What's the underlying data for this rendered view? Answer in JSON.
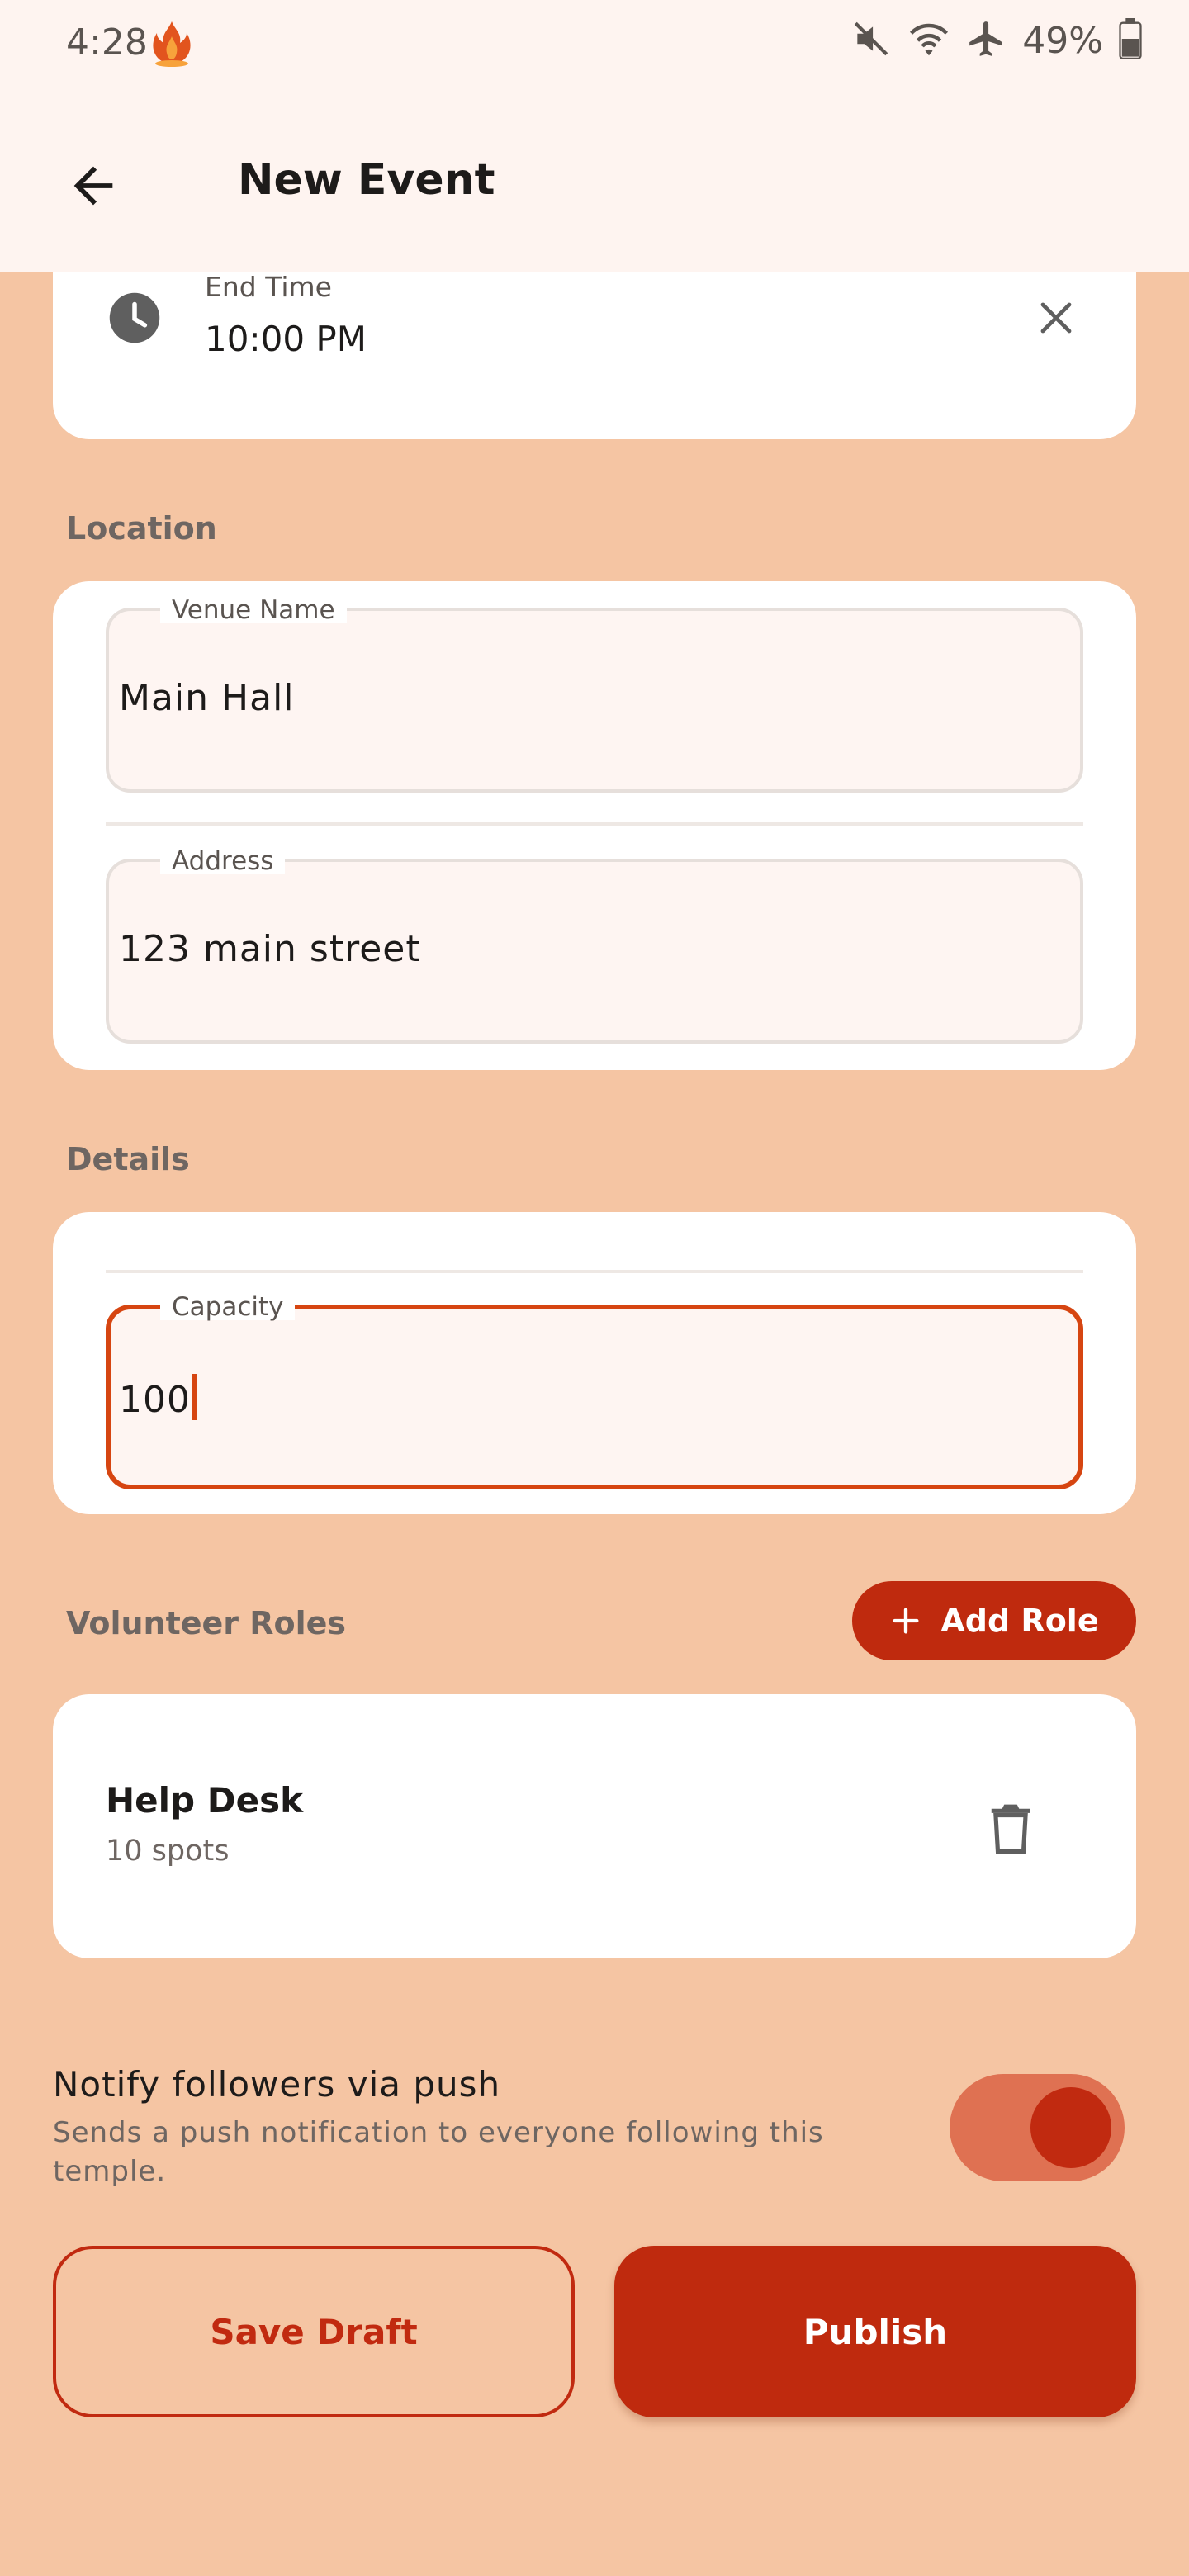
{
  "status_bar": {
    "time": "4:28",
    "battery": "49%",
    "icons": [
      "app-flame-icon",
      "muted-icon",
      "wifi-icon",
      "airplane-icon",
      "battery-icon"
    ]
  },
  "app_bar": {
    "title": "New Event",
    "back_icon": "arrow-back-icon"
  },
  "end_time": {
    "label": "End Time",
    "value": "10:00 PM",
    "icons": [
      "clock-icon",
      "close-icon"
    ]
  },
  "location": {
    "section_label": "Location",
    "venue": {
      "label": "Venue Name",
      "value": "Main Hall"
    },
    "address": {
      "label": "Address",
      "value": "123 main street"
    }
  },
  "details": {
    "section_label": "Details",
    "capacity": {
      "label": "Capacity",
      "value": "100"
    }
  },
  "volunteer_roles": {
    "section_label": "Volunteer Roles",
    "add_button": "Add Role",
    "roles": [
      {
        "name": "Help Desk",
        "spots": "10 spots"
      }
    ]
  },
  "notify": {
    "title": "Notify followers via push",
    "description": "Sends a push notification to everyone following this temple.",
    "enabled": true
  },
  "actions": {
    "save_draft": "Save Draft",
    "publish": "Publish"
  },
  "colors": {
    "background": "#F5C5A3",
    "primary": "#BF2A0E",
    "focus": "#D64511",
    "surface": "#FFFFFF",
    "toggle_track": "#DF7152"
  }
}
